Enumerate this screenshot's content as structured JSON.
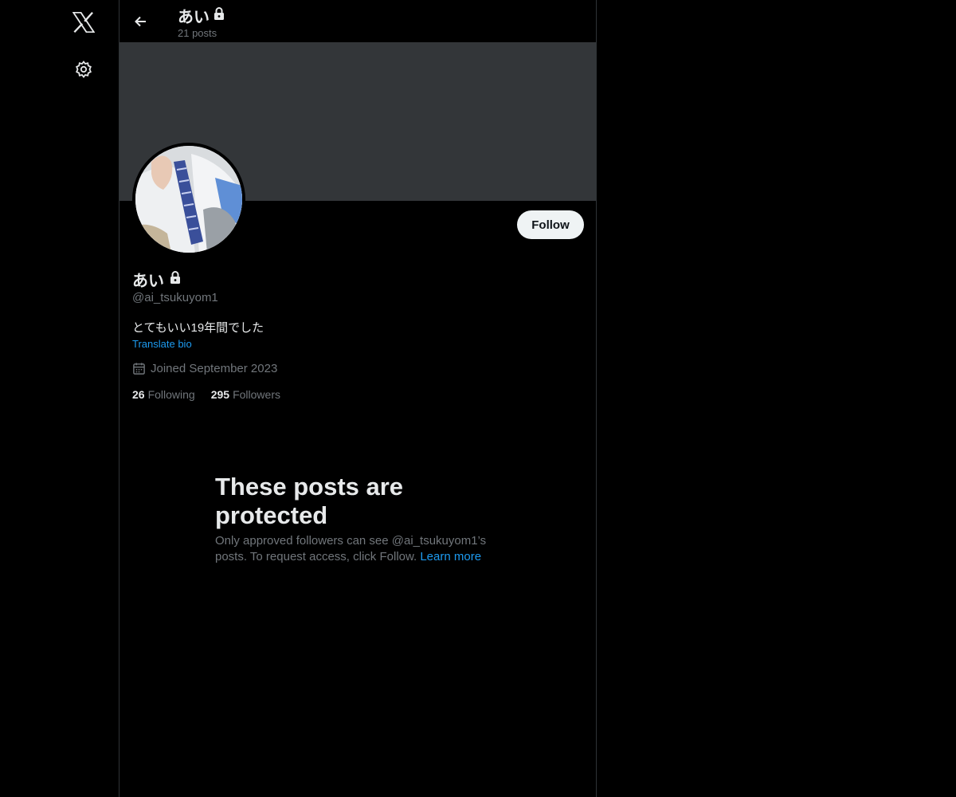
{
  "colors": {
    "accent": "#1d9bf0",
    "background": "#000000",
    "banner": "#333639",
    "muted": "#71767b"
  },
  "nav": {
    "logo_icon": "x-logo-icon",
    "settings_icon": "gear-icon"
  },
  "header": {
    "title": "あい",
    "posts_count": "21 posts",
    "back_icon": "back-arrow-icon",
    "lock_icon": "lock-icon"
  },
  "profile": {
    "name": "あい",
    "handle": "@ai_tsukuyom1",
    "bio": "とてもいい19年間でした",
    "translate_label": "Translate bio",
    "joined": "Joined September 2023",
    "following_count": "26",
    "following_label": "Following",
    "followers_count": "295",
    "followers_label": "Followers",
    "follow_label": "Follow"
  },
  "protected": {
    "title": "These posts are protected",
    "text": "Only approved followers can see @ai_tsukuyom1’s posts. To request access, click Follow.",
    "learn_more": "Learn more"
  }
}
